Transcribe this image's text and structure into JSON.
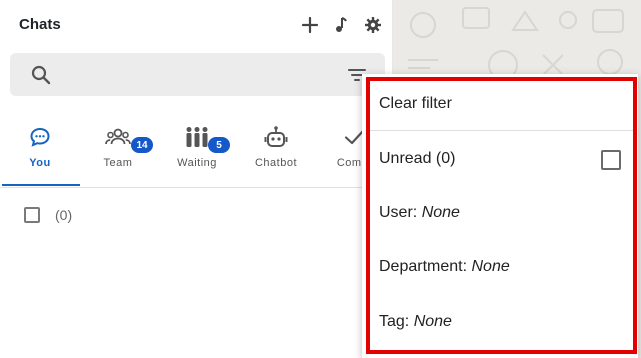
{
  "header": {
    "title": "Chats",
    "icons": [
      "plus-icon",
      "music-note-icon",
      "gear-icon"
    ]
  },
  "search": {
    "value": "",
    "placeholder": "",
    "icons": [
      "search-icon",
      "filter-icon"
    ]
  },
  "tabs": [
    {
      "label": "You",
      "icon": "chat-bubble-icon",
      "active": true,
      "badge": ""
    },
    {
      "label": "Team",
      "icon": "group-icon",
      "active": false,
      "badge": "14"
    },
    {
      "label": "Waiting",
      "icon": "people-queue-icon",
      "active": false,
      "badge": "5"
    },
    {
      "label": "Chatbot",
      "icon": "robot-icon",
      "active": false,
      "badge": ""
    },
    {
      "label": "Compl",
      "icon": "check-icon",
      "active": false,
      "badge": ""
    }
  ],
  "list": {
    "select_all_count": "(0)"
  },
  "filter_menu": {
    "clear_label": "Clear filter",
    "unread_label": "Unread (0)",
    "unread_checked": false,
    "user_label": "User:",
    "user_value": "None",
    "department_label": "Department:",
    "department_value": "None",
    "tag_label": "Tag:",
    "tag_value": "None"
  },
  "colors": {
    "accent": "#1565c0",
    "badge": "#1558c9",
    "highlight_outline": "#e30000",
    "search_bg": "#ececec",
    "pattern_bg": "#eceae6"
  }
}
